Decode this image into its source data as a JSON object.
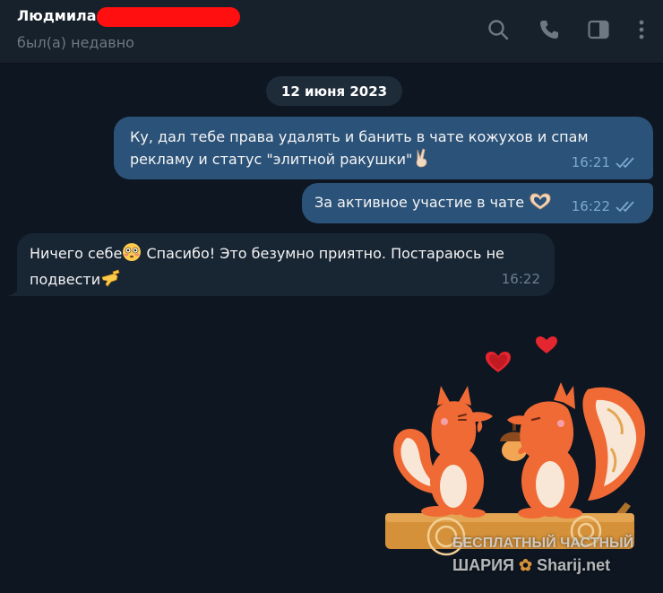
{
  "header": {
    "contact_name": "Людмила",
    "status": "был(а) недавно",
    "icons": [
      "search-icon",
      "phone-icon",
      "sidebar-panel-icon",
      "more-vertical-icon"
    ]
  },
  "chat": {
    "date_separator": "12 июня 2023",
    "messages": [
      {
        "direction": "outgoing",
        "text": "Ку, дал тебе права удалять и банить в чате кожухов и спам рекламу и статус \"элитной ракушки\"",
        "emoji": "victory-hand",
        "time": "16:21",
        "read": true
      },
      {
        "direction": "outgoing",
        "text": "За активное участие в чате",
        "emoji": "heart-hands",
        "time": "16:22",
        "read": true
      },
      {
        "direction": "incoming",
        "text_part1": "Ничего себе",
        "text_part2": " Спасибо! Это безумно приятно. Постараюсь не подвести",
        "emojis": [
          "flushed-face",
          "saluting-hand"
        ],
        "time": "16:22"
      }
    ],
    "sticker": "squirrels-love-sticker"
  },
  "watermark": {
    "line1": "БЕСПЛАТНЫЙ ЧАСТНЫЙ",
    "line2": "ШАРИЯ",
    "line3": "Sharij.net"
  },
  "colors": {
    "background": "#0e1621",
    "header": "#17212b",
    "outgoing_bubble": "#2b5278",
    "incoming_bubble": "#182533",
    "redaction": "#ff0f0f"
  }
}
